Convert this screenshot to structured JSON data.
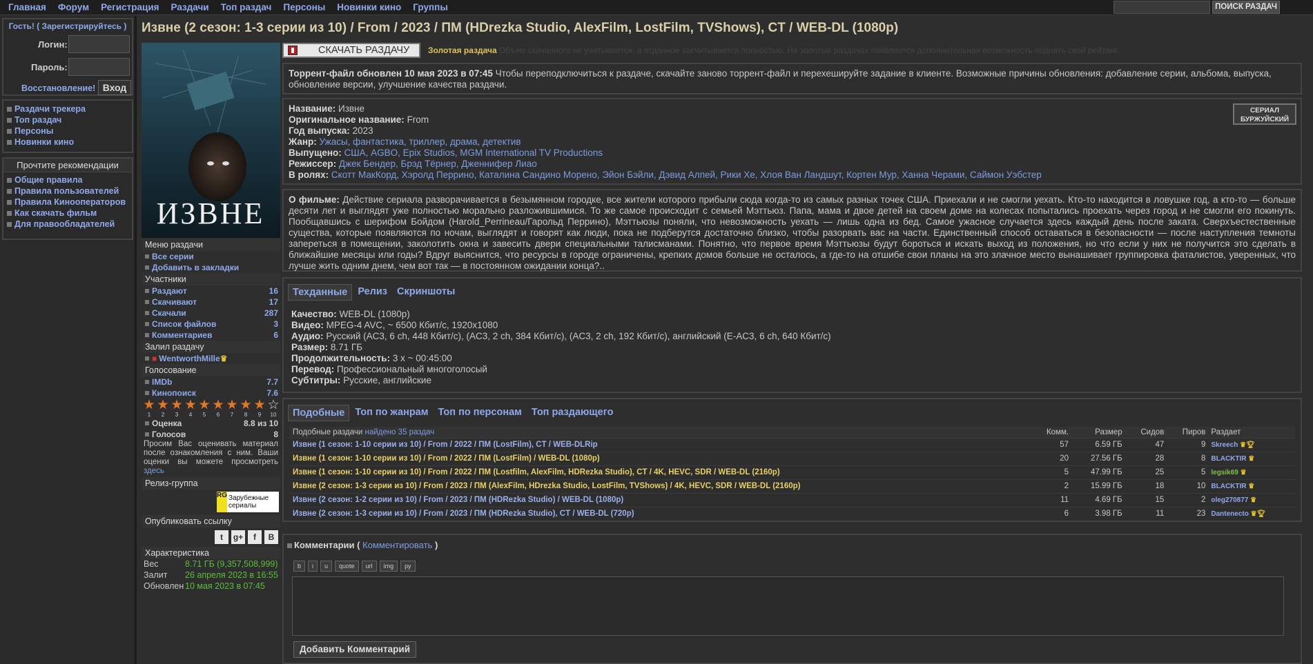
{
  "nav": {
    "items": [
      "Главная",
      "Форум",
      "Регистрация",
      "Раздачи",
      "Топ раздач",
      "Персоны",
      "Новинки кино",
      "Группы"
    ],
    "search_button": "ПОИСК РАЗДАЧ"
  },
  "login": {
    "guest": "Гость! ( Зарегистрируйтесь )",
    "login_label": "Логин:",
    "password_label": "Пароль:",
    "restore": "Восстановление!",
    "enter": "Вход"
  },
  "sidebar": {
    "links": [
      "Раздачи трекера",
      "Топ раздач",
      "Персоны",
      "Новинки кино"
    ],
    "rules_header": "Прочтите рекомендации",
    "rules": [
      "Общие правила",
      "Правила пользователей",
      "Правила Кинооператоров",
      "Как скачать фильм",
      "Для правообладателей"
    ]
  },
  "title": "Извне (2 сезон: 1-3 серии из 10) / From / 2023 / ПМ (HDrezka Studio, AlexFilm, LostFilm, TVShows), CT / WEB-DL (1080p)",
  "poster_text": "ИЗВНЕ",
  "download": {
    "label": "СКАЧАТЬ РАЗДАЧУ",
    "gold_title": "Золотая раздача",
    "gold_text": "Объем скачанного не учитывается, а отданное засчитывается полностью. На золотых раздачах появляется дополнительная возможность поднять свой рейтинг."
  },
  "updated": {
    "bold": "Торрент-файл обновлен 10 мая 2023 в 07:45",
    "text": "Чтобы переподключиться к раздаче, скачайте заново торрент-файл и перехешируйте задание в клиенте. Возможные причины обновления: добавление серии, альбома, выпуска, обновление версии, улучшение качества раздачи."
  },
  "info": {
    "name_k": "Название:",
    "name_v": "Извне",
    "orig_k": "Оригинальное название:",
    "orig_v": "From",
    "year_k": "Год выпуска:",
    "year_v": "2023",
    "genre_k": "Жанр:",
    "genre_v": "Ужасы, фантастика, триллер, драма, детектив",
    "made_k": "Выпущено:",
    "made_v": "США, AGBO, Epix Studios, MGM International TV Productions",
    "dir_k": "Режиссер:",
    "dir_v": "Джек Бендер, Брэд Тёрнер, Дженнифер Лиао",
    "cast_k": "В ролях:",
    "cast_v": "Скотт МакКорд, Хэролд Перрино, Каталина Сандино Морено, Эйон Бэйли, Дэвид Алпей, Рики Хе, Хлоя Ван Ландшут, Кортен Мур, Ханна Черами, Саймон Уэбстер",
    "badge_top": "СЕРИАЛ",
    "badge_bottom": "БУРЖУЙСКИЙ"
  },
  "about": {
    "bold": "О фильме:",
    "text": "Действие сериала разворачивается в безымянном городке, все жители которого прибыли сюда когда-то из самых разных точек США. Приехали и не смогли уехать. Кто-то находится в ловушке год, а кто-то — больше десяти лет и выглядят уже полностью морально разложившимися. То же самое происходит с семьей Мэттьюз. Папа, мама и двое детей на своем доме на колесах попытались проехать через город и не смогли его покинуть. Пообщавшись с шерифом Бойдом (Harold_Perrineau/Гарольд Перрино), Мэттьюзы поняли, что невозможность уехать — лишь одна из бед. Самое ужасное случается здесь каждый день после заката. Сверхъестественные существа, которые появляются по ночам, выглядят и говорят как люди, пока не подберутся достаточно близко, чтобы разорвать вас на части. Единственный способ оставаться в безопасности — после наступления темноты запереться в помещении, заколотить окна и завесить двери специальными талисманами. Понятно, что первое время Мэттьюзы будут бороться и искать выход из положения, но что если у них не получится это сделать в ближайшие месяцы или годы? Вдруг выяснится, что ресурсы в городе ограничены, крепких домов больше не осталось, а где-то на отшибе свои планы на это злачное место вынашивает группировка фаталистов, уверенных, что лучше жить одним днем, чем вот так — в постоянном ожидании конца?.."
  },
  "tech": {
    "tabs": [
      "Техданные",
      "Релиз",
      "Скриншоты"
    ],
    "rows": [
      [
        "Качество:",
        "WEB-DL (1080p)"
      ],
      [
        "Видео:",
        "MPEG-4 AVC, ~ 6500 Кбит/с, 1920x1080"
      ],
      [
        "Аудио:",
        "Русский (AC3, 6 ch, 448 Кбит/с), (AC3, 2 ch, 384 Кбит/с), (AC3, 2 ch, 192 Кбит/с), английский (E-AC3, 6 ch, 640 Кбит/с)"
      ],
      [
        "Размер:",
        "8.71 ГБ"
      ],
      [
        "Продолжительность:",
        "3 x ~ 00:45:00"
      ],
      [
        "Перевод:",
        "Профессиональный многоголосый"
      ],
      [
        "Субтитры:",
        "Русские, английские"
      ]
    ]
  },
  "similar": {
    "tabs": [
      "Подобные",
      "Топ по жанрам",
      "Топ по персонам",
      "Топ раздающего"
    ],
    "header_label": "Подобные раздачи",
    "header_found": "найдено 35 раздач",
    "cols": [
      "Комм.",
      "Размер",
      "Сидов",
      "Пиров",
      "Раздает"
    ],
    "rows": [
      [
        "Извне (1 сезон: 1-10 серии из 10) / From / 2022 / ПМ (LostFilm), CT / WEB-DLRip",
        "57",
        "6.59 ГБ",
        "47",
        "9",
        "Skreech"
      ],
      [
        "Извне (1 сезон: 1-10 серии из 10) / From / 2022 / ПМ (LostFilm) / WEB-DL (1080p)",
        "20",
        "27.56 ГБ",
        "28",
        "8",
        "BLACKTIR"
      ],
      [
        "Извне (1 сезон: 1-10 серии из 10) / From / 2022 / ПМ (Lostfilm, AlexFilm, HDRezka Studio), CT / 4K, HEVC, SDR / WEB-DL (2160p)",
        "5",
        "47.99 ГБ",
        "25",
        "5",
        "legsik69"
      ],
      [
        "Извне (2 сезон: 1-3 серии из 10) / From / 2023 / ПМ (AlexFilm, HDrezka Studio, LostFilm, TVShows) / 4K, HEVC, SDR / WEB-DL (2160p)",
        "2",
        "15.99 ГБ",
        "18",
        "10",
        "BLACKTIR"
      ],
      [
        "Извне (2 сезон: 1-2 серии из 10) / From / 2023 / ПМ (HDRezka Studio) / WEB-DL (1080p)",
        "11",
        "4.69 ГБ",
        "15",
        "2",
        "oleg270877"
      ],
      [
        "Извне (2 сезон: 1-3 серии из 10) / From / 2023 / ПМ (HDRezka Studio), CT / WEB-DL (720p)",
        "6",
        "3.98 ГБ",
        "11",
        "23",
        "Dantenecto"
      ]
    ]
  },
  "comments": {
    "title": "Комментарии",
    "link": "Комментировать",
    "bb": [
      "b",
      "i",
      "u",
      "quote",
      "url",
      "img",
      "ру"
    ],
    "add": "Добавить Комментарий"
  },
  "menu": {
    "header": "Меню раздачи",
    "items": [
      "Все серии",
      "Добавить в закладки"
    ]
  },
  "participants": {
    "header": "Участники",
    "rows": [
      [
        "Раздают",
        "16"
      ],
      [
        "Скачивают",
        "17"
      ],
      [
        "Скачали",
        "287"
      ],
      [
        "Список файлов",
        "3"
      ],
      [
        "Комментариев",
        "6"
      ]
    ]
  },
  "uploader": {
    "header": "Залил раздачу",
    "name": "WentworthMille"
  },
  "voting": {
    "header": "Голосование",
    "rows": [
      [
        "IMDb",
        "7.7"
      ],
      [
        "Кинопоиск",
        "7.6"
      ]
    ],
    "score_k": "Оценка",
    "score_v": "8.8 из 10",
    "votes_k": "Голосов",
    "votes_v": "8",
    "stars": [
      "1",
      "2",
      "3",
      "4",
      "5",
      "6",
      "7",
      "8",
      "9",
      "10"
    ],
    "note": "Просим Вас оценивать материал после ознакомления с ним. Ваши оценки вы можете просмотреть",
    "note_link": "здесь"
  },
  "release_group": {
    "header": "Релиз-группа",
    "logo_text": "Зарубежные сериалы"
  },
  "publish": {
    "header": "Опубликовать ссылку",
    "buttons": [
      "t",
      "g+",
      "f",
      "В"
    ]
  },
  "chars": {
    "header": "Характеристика",
    "rows": [
      [
        "Вес",
        "8.71 ГБ (9,357,508,999)"
      ],
      [
        "Залит",
        "26 апреля 2023 в 16:55"
      ],
      [
        "Обновлен",
        "10 мая 2023 в 07:45"
      ]
    ]
  }
}
